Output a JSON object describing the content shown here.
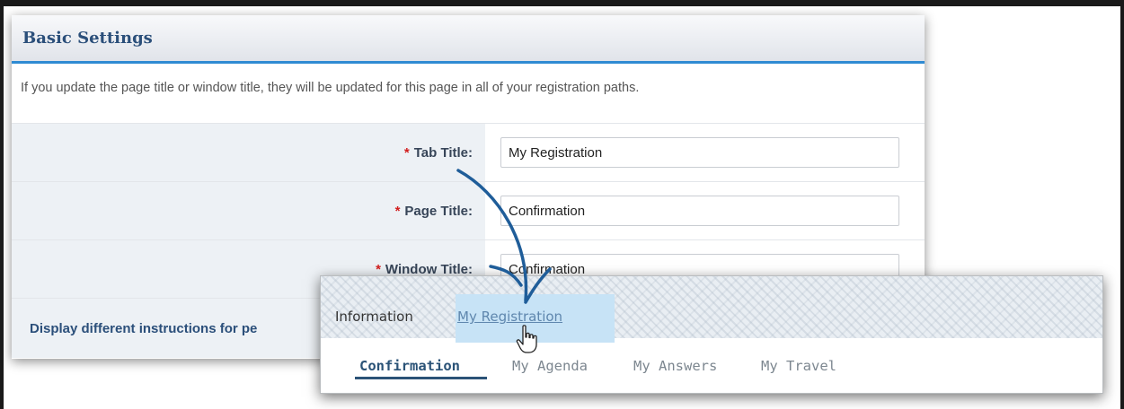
{
  "panel": {
    "title": "Basic Settings",
    "intro": "If you update the page title or window title, they will be updated for this page in all of your registration paths.",
    "required_marker": "*",
    "fields": [
      {
        "label": "Tab Title:",
        "value": "My Registration"
      },
      {
        "label": "Page Title:",
        "value": "Confirmation"
      },
      {
        "label": "Window Title:",
        "value": "Confirmation"
      }
    ],
    "instructions_label": "Display different instructions for pe"
  },
  "nav_preview": {
    "tabs": [
      {
        "label": "Information",
        "state": "inactive"
      },
      {
        "label": "My Registration",
        "state": "highlighted"
      }
    ],
    "subtabs": [
      {
        "label": "Confirmation",
        "state": "active"
      },
      {
        "label": "My Agenda",
        "state": "inactive"
      },
      {
        "label": "My Answers",
        "state": "inactive"
      },
      {
        "label": "My Travel",
        "state": "inactive"
      }
    ],
    "cursor_icon": "hand-pointer-icon"
  },
  "colors": {
    "accent_blue": "#2f8bd3",
    "heading_navy": "#2b4f7a",
    "required_red": "#d21e1e",
    "tab_highlight": "#c7e3f6",
    "annotation_arrow": "#1f5d99"
  }
}
